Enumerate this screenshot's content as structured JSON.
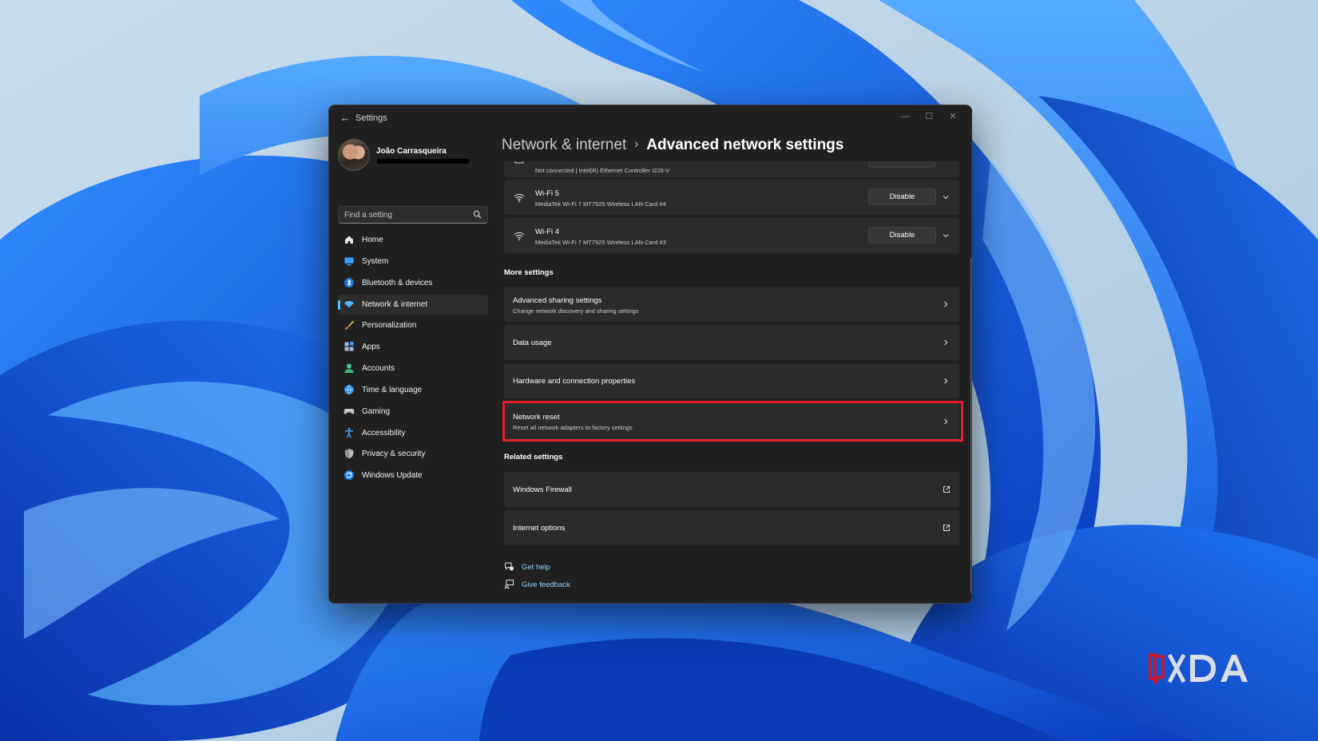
{
  "window": {
    "title": "Settings",
    "back_label": "←",
    "minimize_glyph": "—",
    "maximize_glyph": "☐",
    "close_glyph": "✕"
  },
  "profile": {
    "name": "João Carrasqueira"
  },
  "search": {
    "placeholder": "Find a setting"
  },
  "nav": [
    {
      "label": "Home",
      "icon": "home-icon",
      "color": "#d8d8d8"
    },
    {
      "label": "System",
      "icon": "system-icon",
      "color": "#3aa0ff"
    },
    {
      "label": "Bluetooth & devices",
      "icon": "bluetooth-icon",
      "color": "#3aa0ff"
    },
    {
      "label": "Network & internet",
      "icon": "network-icon",
      "color": "#60c5ff",
      "active": true
    },
    {
      "label": "Personalization",
      "icon": "brush-icon",
      "color": "#e8a25a"
    },
    {
      "label": "Apps",
      "icon": "apps-icon",
      "color": "#9ab8d8"
    },
    {
      "label": "Accounts",
      "icon": "accounts-icon",
      "color": "#3fcf8e"
    },
    {
      "label": "Time & language",
      "icon": "globe-clock-icon",
      "color": "#3aa0ff"
    },
    {
      "label": "Gaming",
      "icon": "gamepad-icon",
      "color": "#bdbdbd"
    },
    {
      "label": "Accessibility",
      "icon": "accessibility-icon",
      "color": "#3aa0ff"
    },
    {
      "label": "Privacy & security",
      "icon": "shield-icon",
      "color": "#9e9e9e"
    },
    {
      "label": "Windows Update",
      "icon": "update-icon",
      "color": "#3aa0ff"
    }
  ],
  "breadcrumb": {
    "parent": "Network & internet",
    "separator": "›",
    "current": "Advanced network settings"
  },
  "adapters": {
    "ethernet_partial_sub": "Not connected | Intel(R) Ethernet Controller I226-V",
    "items": [
      {
        "name": "Wi-Fi 5",
        "description": "MediaTek Wi-Fi 7 MT7925 Wireless LAN Card #4",
        "button": "Disable"
      },
      {
        "name": "Wi-Fi 4",
        "description": "MediaTek Wi-Fi 7 MT7925 Wireless LAN Card #3",
        "button": "Disable"
      }
    ]
  },
  "more_settings": {
    "heading": "More settings",
    "items": [
      {
        "title": "Advanced sharing settings",
        "subtitle": "Change network discovery and sharing settings"
      },
      {
        "title": "Data usage"
      },
      {
        "title": "Hardware and connection properties"
      },
      {
        "title": "Network reset",
        "subtitle": "Reset all network adapters to factory settings",
        "highlighted": true
      }
    ]
  },
  "related_settings": {
    "heading": "Related settings",
    "items": [
      {
        "title": "Windows Firewall"
      },
      {
        "title": "Internet options"
      }
    ]
  },
  "help": {
    "get_help": "Get help",
    "give_feedback": "Give feedback"
  },
  "colors": {
    "accent": "#4cc2ff",
    "highlight_box": "#e5202a",
    "window_bg": "#202020",
    "card_bg": "#2b2b2b",
    "wallpaper_blue": "#0a5ee0"
  }
}
